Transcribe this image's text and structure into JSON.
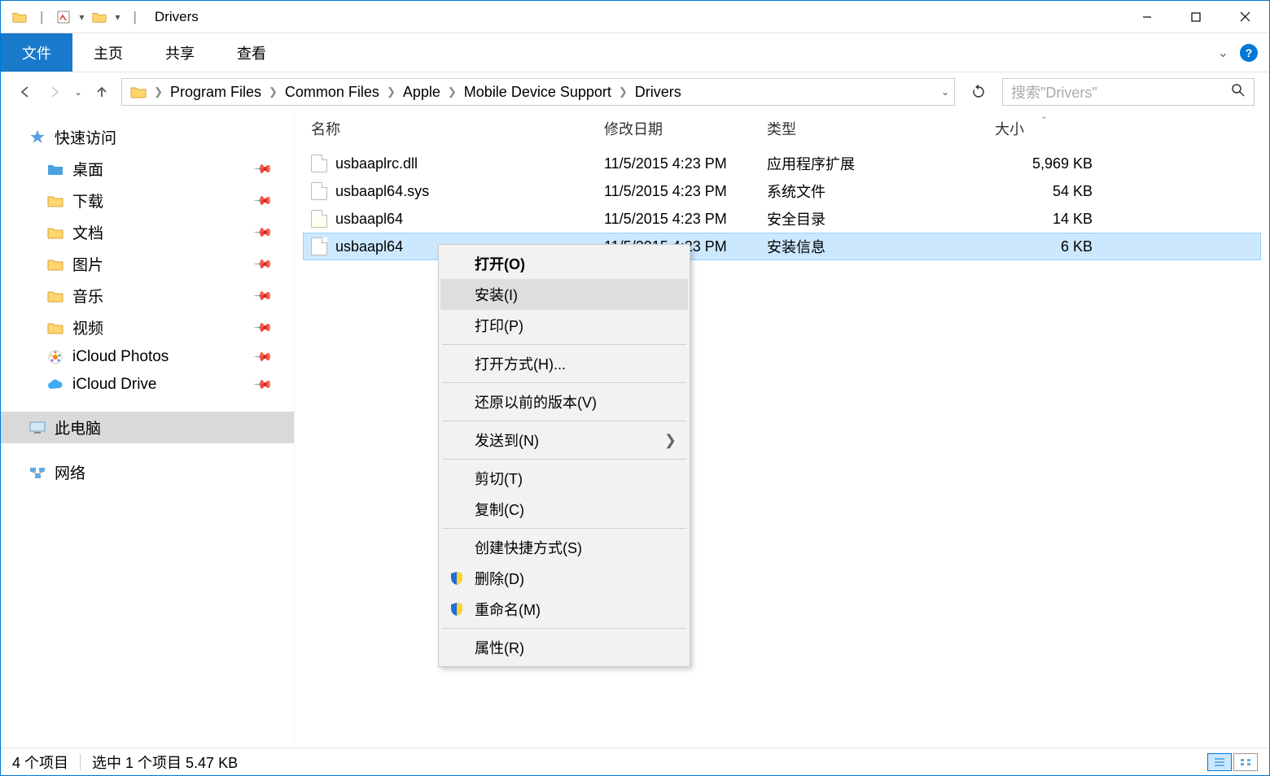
{
  "titlebar": {
    "title": "Drivers"
  },
  "ribbon": {
    "file": "文件",
    "home": "主页",
    "share": "共享",
    "view": "查看"
  },
  "breadcrumb": [
    "Program Files",
    "Common Files",
    "Apple",
    "Mobile Device Support",
    "Drivers"
  ],
  "search": {
    "placeholder": "搜索\"Drivers\""
  },
  "sidebar": {
    "quick_access": "快速访问",
    "desktop": "桌面",
    "downloads": "下载",
    "documents": "文档",
    "pictures": "图片",
    "music": "音乐",
    "videos": "视频",
    "icloud_photos": "iCloud Photos",
    "icloud_drive": "iCloud Drive",
    "this_pc": "此电脑",
    "network": "网络"
  },
  "columns": {
    "name": "名称",
    "date": "修改日期",
    "type": "类型",
    "size": "大小"
  },
  "files": [
    {
      "name": "usbaaplrc.dll",
      "date": "11/5/2015 4:23 PM",
      "type": "应用程序扩展",
      "size": "5,969 KB"
    },
    {
      "name": "usbaapl64.sys",
      "date": "11/5/2015 4:23 PM",
      "type": "系统文件",
      "size": "54 KB"
    },
    {
      "name": "usbaapl64",
      "date": "11/5/2015 4:23 PM",
      "type": "安全目录",
      "size": "14 KB"
    },
    {
      "name": "usbaapl64",
      "date": "11/5/2015 4:23 PM",
      "type": "安装信息",
      "size": "6 KB"
    }
  ],
  "context_menu": {
    "open": "打开(O)",
    "install": "安装(I)",
    "print": "打印(P)",
    "open_with": "打开方式(H)...",
    "restore_previous": "还原以前的版本(V)",
    "send_to": "发送到(N)",
    "cut": "剪切(T)",
    "copy": "复制(C)",
    "create_shortcut": "创建快捷方式(S)",
    "delete": "删除(D)",
    "rename": "重命名(M)",
    "properties": "属性(R)"
  },
  "status": {
    "item_count": "4 个项目",
    "selection": "选中 1 个项目 5.47 KB"
  }
}
